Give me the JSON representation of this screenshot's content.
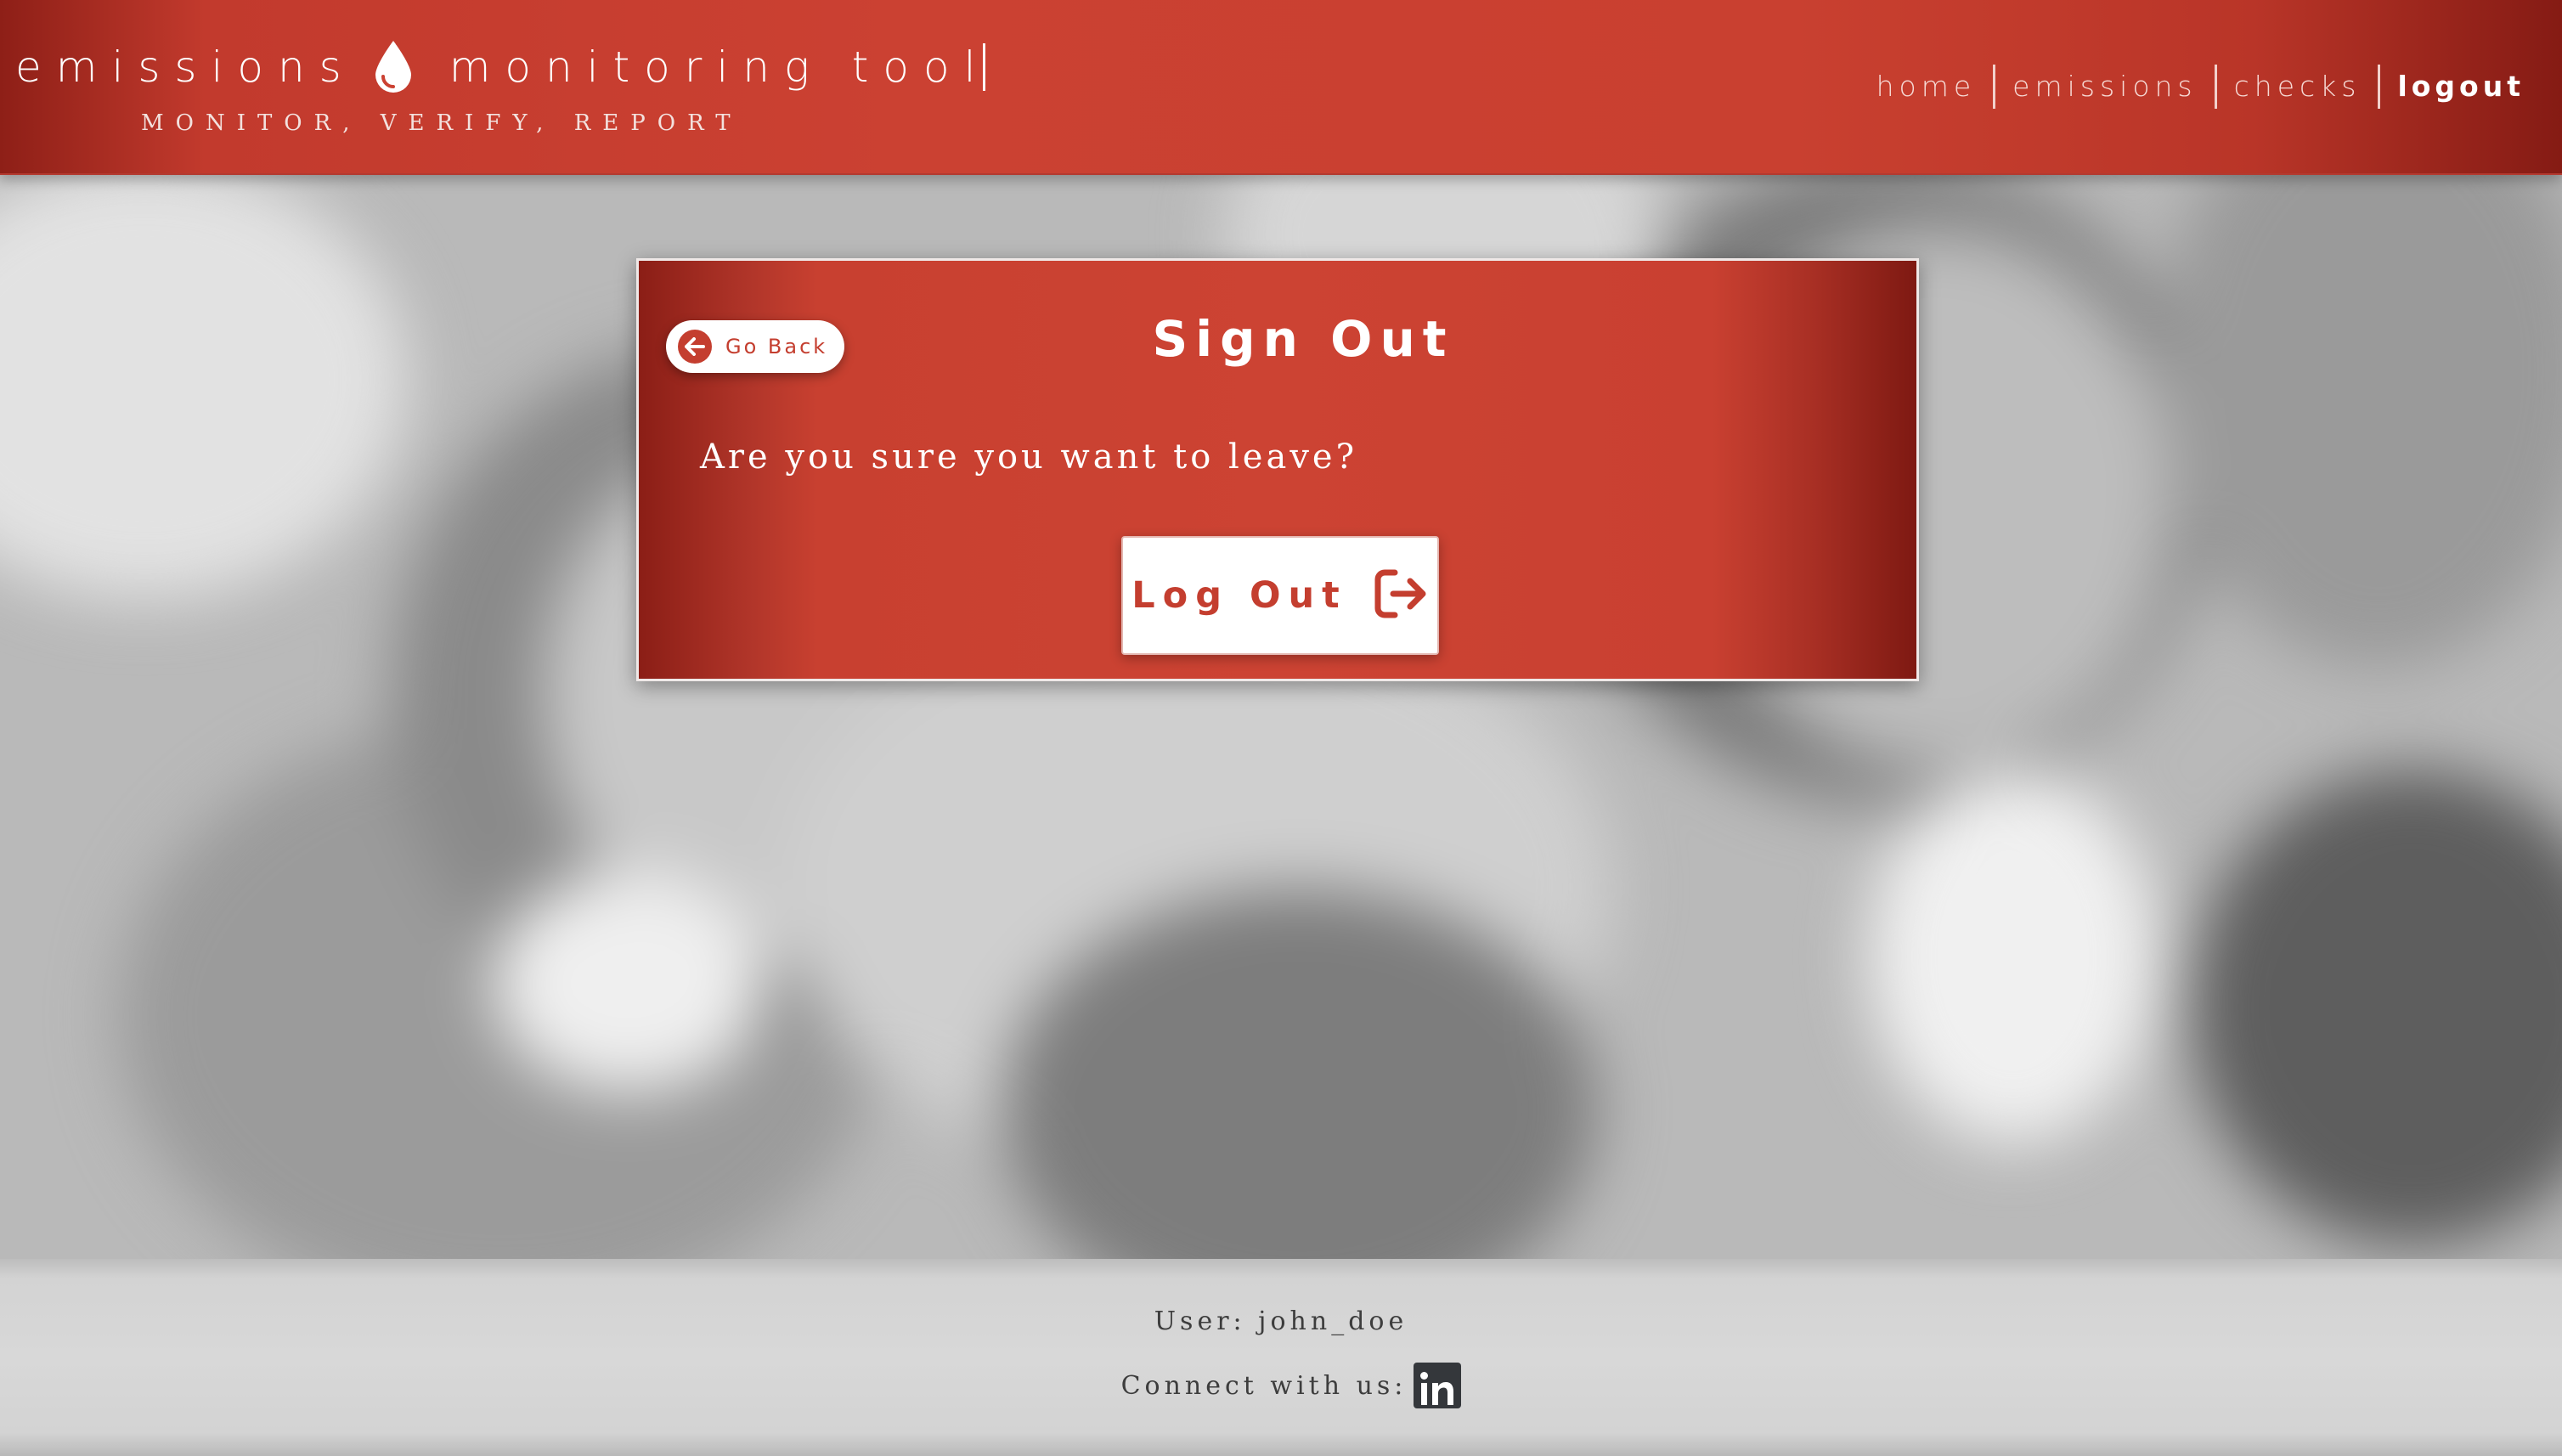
{
  "header": {
    "brand_left": "emissions",
    "brand_right": "monitoring tool",
    "tagline": "MONITOR, VERIFY, REPORT",
    "logo_icon": "water-drop-icon",
    "nav": [
      {
        "label": "home",
        "active": false
      },
      {
        "label": "emissions",
        "active": false
      },
      {
        "label": "checks",
        "active": false
      },
      {
        "label": "logout",
        "active": true
      }
    ]
  },
  "card": {
    "go_back_label": "Go Back",
    "go_back_icon": "arrow-left-circle-icon",
    "title": "Sign Out",
    "question": "Are you sure you want to leave?",
    "logout_label": "Log Out",
    "logout_icon": "sign-out-icon"
  },
  "footer": {
    "user": "User: john_doe",
    "connect_label": "Connect with us:",
    "social_icon": "linkedin-icon"
  },
  "colors": {
    "brand_red": "#cb4132",
    "brand_dark_red": "#8e1f17",
    "button_text_red": "#c43e2f",
    "footer_bg": "#d8d8d8",
    "footer_text": "#3d3d3d"
  }
}
